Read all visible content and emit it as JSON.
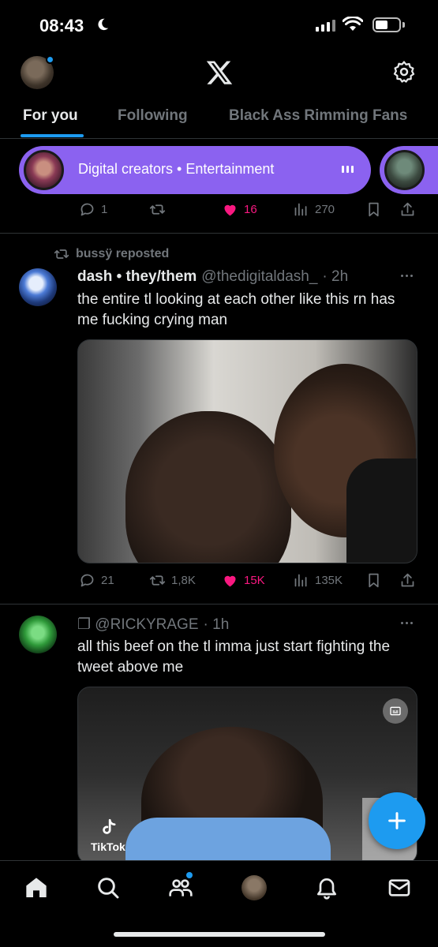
{
  "status_bar": {
    "time": "08:43"
  },
  "tabs": [
    {
      "label": "For you",
      "active": true
    },
    {
      "label": "Following",
      "active": false
    },
    {
      "label": "Black Ass Rimming Fans",
      "active": false
    }
  ],
  "community_pill": {
    "label": "Digital creators • Entertainment"
  },
  "prev_tweet_actions": {
    "replies": "1",
    "reposts": "",
    "likes": "16",
    "views": "270"
  },
  "tweet1": {
    "repost_label": "bussÿ reposted",
    "name": "dash • they/them",
    "handle": "@thedigitaldash_",
    "time": "· 2h",
    "text": "the entire tl looking at each other like this rn has me fucking crying man",
    "actions": {
      "replies": "21",
      "reposts": "1,8K",
      "likes": "15K",
      "views": "135K"
    }
  },
  "tweet2": {
    "handle": "❐ @RICKYRAGE",
    "time": "· 1h",
    "text": "all this beef on the tl imma just start fighting the tweet above me",
    "media_watermark": "TikTok"
  },
  "colors": {
    "accent": "#1d9bf0",
    "like": "#f91880",
    "community": "#8b62f0",
    "muted": "#71767b"
  },
  "icons": {
    "header": [
      "x-logo-icon",
      "gear-icon"
    ],
    "bottom_nav": [
      "home-icon",
      "search-icon",
      "communities-icon",
      "profile-avatar",
      "bell-icon",
      "mail-icon"
    ]
  }
}
